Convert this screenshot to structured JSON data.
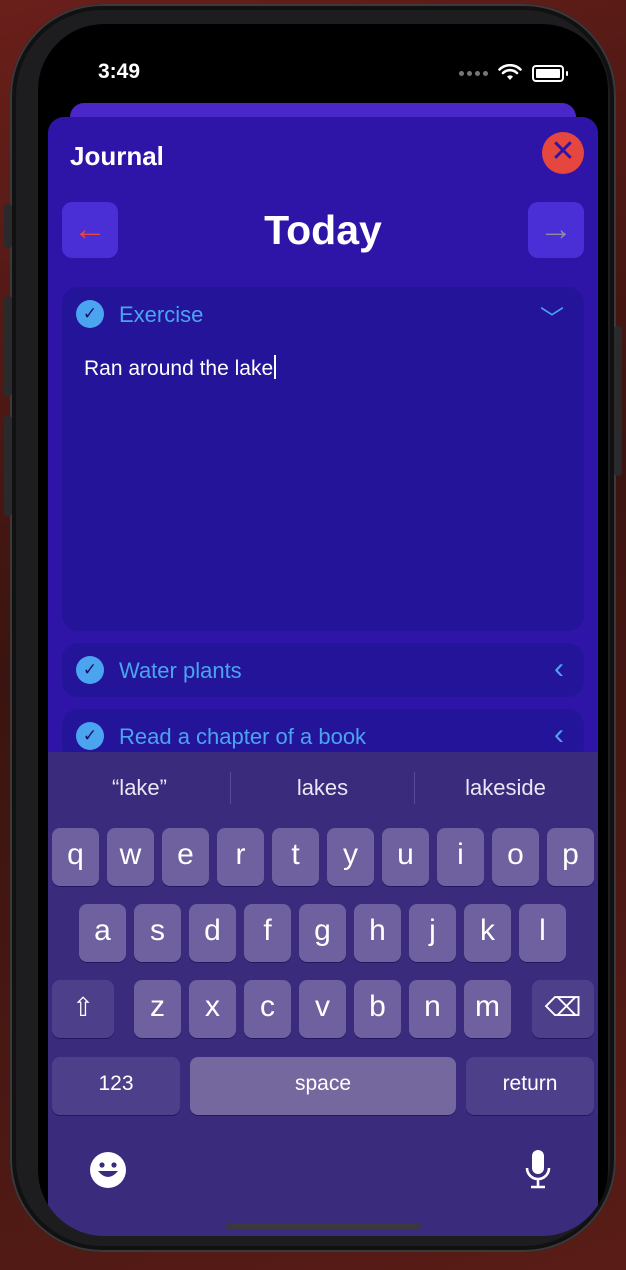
{
  "status_bar": {
    "time": "3:49"
  },
  "app": {
    "title": "Journal",
    "close_symbol": "✕",
    "day_label": "Today",
    "prev_symbol": "←",
    "next_symbol": "→",
    "check_symbol": "✓"
  },
  "tasks": [
    {
      "label": "Exercise",
      "chevron": "﹀",
      "note": "Ran around the lake"
    },
    {
      "label": "Water plants",
      "chevron": "‹"
    },
    {
      "label": "Read a chapter of a book",
      "chevron": "‹"
    }
  ],
  "keyboard": {
    "suggestions": [
      "“lake”",
      "lakes",
      "lakeside"
    ],
    "row1": [
      "q",
      "w",
      "e",
      "r",
      "t",
      "y",
      "u",
      "i",
      "o",
      "p"
    ],
    "row2": [
      "a",
      "s",
      "d",
      "f",
      "g",
      "h",
      "j",
      "k",
      "l"
    ],
    "row3": [
      "z",
      "x",
      "c",
      "v",
      "b",
      "n",
      "m"
    ],
    "numbers_label": "123",
    "space_label": "space",
    "return_label": "return",
    "shift_symbol": "⇧",
    "delete_symbol": "⌫"
  },
  "colors": {
    "accent_blue": "#4ba4f0",
    "close_red": "#e5463e",
    "sheet_bg": "#2e15a8"
  }
}
